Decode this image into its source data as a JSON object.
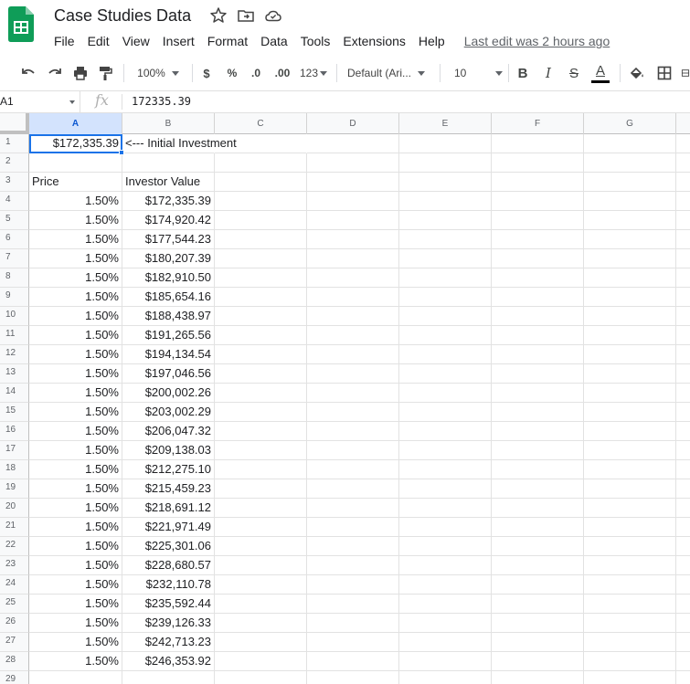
{
  "app": {
    "title": "Case Studies Data",
    "last_edit": "Last edit was 2 hours ago",
    "brand_color": "#0f9d58"
  },
  "menu": [
    "File",
    "Edit",
    "View",
    "Insert",
    "Format",
    "Data",
    "Tools",
    "Extensions",
    "Help"
  ],
  "toolbar": {
    "zoom": "100%",
    "currency": "$",
    "percent": "%",
    "decrease_decimal": ".0",
    "increase_decimal": ".00",
    "more_formats": "123",
    "font": "Default (Ari...",
    "font_size": "10",
    "bold": "B",
    "italic": "I",
    "strike": "S",
    "text_color": "A",
    "icons": [
      "undo-icon",
      "redo-icon",
      "print-icon",
      "paint-format-icon",
      "fill-color-icon",
      "borders-icon",
      "merge-icon"
    ]
  },
  "formula_bar": {
    "name_box": "A1",
    "fx": "fx",
    "value": "172335.39"
  },
  "columns": [
    "A",
    "B",
    "C",
    "D",
    "E",
    "F",
    "G"
  ],
  "selected_cell": "A1",
  "rows": [
    {
      "n": "1",
      "a": "$172,335.39",
      "b": "<--- Initial Investment"
    },
    {
      "n": "2",
      "a": "",
      "b": ""
    },
    {
      "n": "3",
      "a": "Price",
      "b": "Investor Value"
    },
    {
      "n": "4",
      "a": "1.50%",
      "b": "$172,335.39"
    },
    {
      "n": "5",
      "a": "1.50%",
      "b": "$174,920.42"
    },
    {
      "n": "6",
      "a": "1.50%",
      "b": "$177,544.23"
    },
    {
      "n": "7",
      "a": "1.50%",
      "b": "$180,207.39"
    },
    {
      "n": "8",
      "a": "1.50%",
      "b": "$182,910.50"
    },
    {
      "n": "9",
      "a": "1.50%",
      "b": "$185,654.16"
    },
    {
      "n": "10",
      "a": "1.50%",
      "b": "$188,438.97"
    },
    {
      "n": "11",
      "a": "1.50%",
      "b": "$191,265.56"
    },
    {
      "n": "12",
      "a": "1.50%",
      "b": "$194,134.54"
    },
    {
      "n": "13",
      "a": "1.50%",
      "b": "$197,046.56"
    },
    {
      "n": "14",
      "a": "1.50%",
      "b": "$200,002.26"
    },
    {
      "n": "15",
      "a": "1.50%",
      "b": "$203,002.29"
    },
    {
      "n": "16",
      "a": "1.50%",
      "b": "$206,047.32"
    },
    {
      "n": "17",
      "a": "1.50%",
      "b": "$209,138.03"
    },
    {
      "n": "18",
      "a": "1.50%",
      "b": "$212,275.10"
    },
    {
      "n": "19",
      "a": "1.50%",
      "b": "$215,459.23"
    },
    {
      "n": "20",
      "a": "1.50%",
      "b": "$218,691.12"
    },
    {
      "n": "21",
      "a": "1.50%",
      "b": "$221,971.49"
    },
    {
      "n": "22",
      "a": "1.50%",
      "b": "$225,301.06"
    },
    {
      "n": "23",
      "a": "1.50%",
      "b": "$228,680.57"
    },
    {
      "n": "24",
      "a": "1.50%",
      "b": "$232,110.78"
    },
    {
      "n": "25",
      "a": "1.50%",
      "b": "$235,592.44"
    },
    {
      "n": "26",
      "a": "1.50%",
      "b": "$239,126.33"
    },
    {
      "n": "27",
      "a": "1.50%",
      "b": "$242,713.23"
    },
    {
      "n": "28",
      "a": "1.50%",
      "b": "$246,353.92"
    },
    {
      "n": "29",
      "a": "",
      "b": ""
    }
  ]
}
